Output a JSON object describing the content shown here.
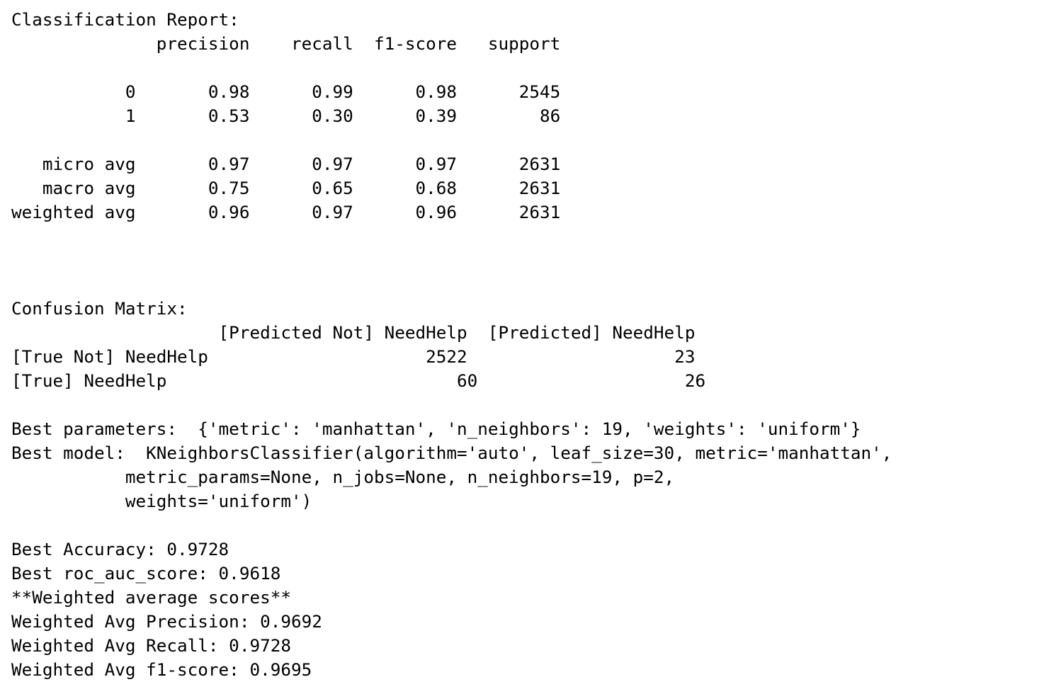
{
  "classification_report": {
    "title": "Classification Report:",
    "header": "              precision    recall  f1-score   support",
    "rows": [
      "",
      "           0       0.98      0.99      0.98      2545",
      "           1       0.53      0.30      0.39        86",
      "",
      "   micro avg       0.97      0.97      0.97      2631",
      "   macro avg       0.75      0.65      0.68      2631",
      "weighted avg       0.96      0.97      0.96      2631"
    ]
  },
  "confusion_matrix": {
    "title": "Confusion Matrix:",
    "header": "                    [Predicted Not] NeedHelp  [Predicted] NeedHelp",
    "rows": [
      "[True Not] NeedHelp                     2522                    23",
      "[True] NeedHelp                            60                    26"
    ]
  },
  "best": {
    "parameters": "Best parameters:  {'metric': 'manhattan', 'n_neighbors': 19, 'weights': 'uniform'}",
    "model_lines": [
      "Best model:  KNeighborsClassifier(algorithm='auto', leaf_size=30, metric='manhattan',",
      "           metric_params=None, n_jobs=None, n_neighbors=19, p=2,",
      "           weights='uniform')"
    ]
  },
  "scores": {
    "accuracy": "Best Accuracy: 0.9728",
    "roc_auc": "Best roc_auc_score: 0.9618",
    "weighted_header": "**Weighted average scores**",
    "weighted_precision": "Weighted Avg Precision: 0.9692",
    "weighted_recall": "Weighted Avg Recall: 0.9728",
    "weighted_f1": "Weighted Avg f1-score: 0.9695"
  }
}
